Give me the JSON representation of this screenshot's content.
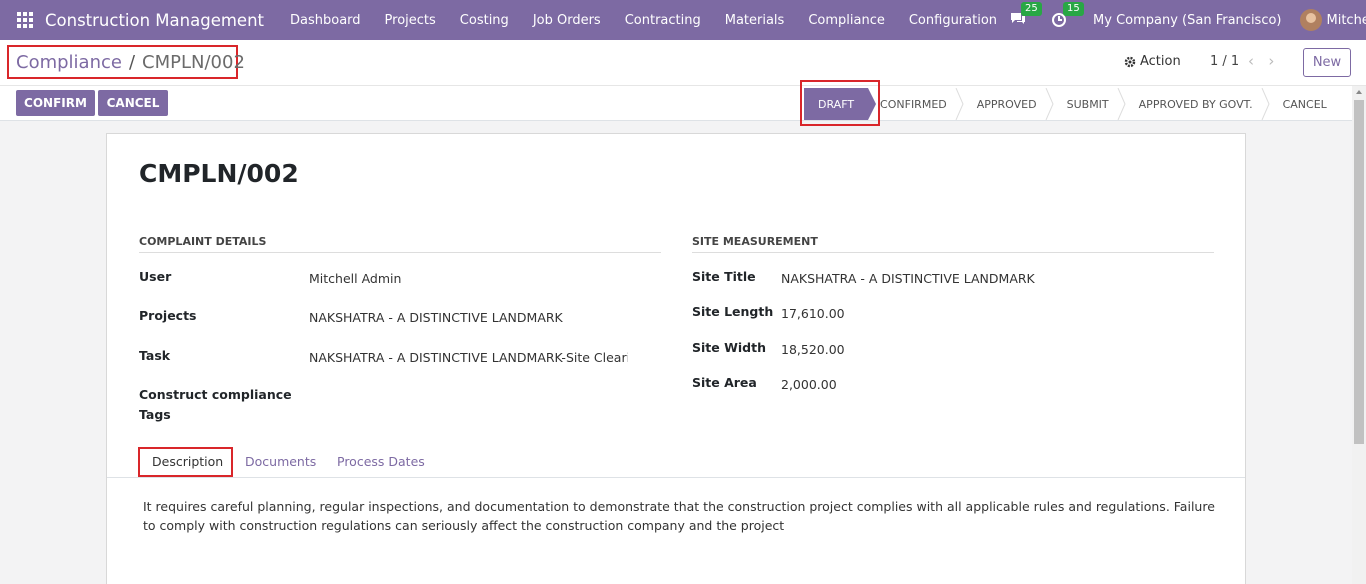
{
  "navbar": {
    "app_title": "Construction Management",
    "menu": [
      "Dashboard",
      "Projects",
      "Costing",
      "Job Orders",
      "Contracting",
      "Materials",
      "Compliance",
      "Configuration"
    ],
    "messages_badge": "25",
    "activities_badge": "15",
    "company": "My Company (San Francisco)",
    "user": "Mitchell Admin",
    "accent_color": "#7d6aa3"
  },
  "control": {
    "breadcrumb_parent": "Compliance",
    "breadcrumb_sep": "/",
    "breadcrumb_current": "CMPLN/002",
    "action_label": "Action",
    "pager": "1 / 1",
    "new_label": "New",
    "confirm_label": "CONFIRM",
    "cancel_label": "CANCEL"
  },
  "status": {
    "stages": [
      "DRAFT",
      "CONFIRMED",
      "APPROVED",
      "SUBMIT",
      "APPROVED BY GOVT.",
      "CANCEL"
    ],
    "active": "DRAFT"
  },
  "record": {
    "name": "CMPLN/002",
    "complaint_details": {
      "title": "COMPLAINT DETAILS",
      "user_label": "User",
      "user_value": "Mitchell Admin",
      "projects_label": "Projects",
      "projects_value": "NAKSHATRA - A DISTINCTIVE LANDMARK",
      "task_label": "Task",
      "task_value": "NAKSHATRA - A DISTINCTIVE LANDMARK-Site Clearing",
      "tags_label_1": "Construct compliance",
      "tags_label_2": "Tags"
    },
    "site_measurement": {
      "title": "SITE MEASUREMENT",
      "site_title_label": "Site Title",
      "site_title_value": "NAKSHATRA - A DISTINCTIVE LANDMARK",
      "length_label": "Site Length",
      "length_value": "17,610.00",
      "width_label": "Site Width",
      "width_value": "18,520.00",
      "area_label": "Site Area",
      "area_value": "2,000.00"
    }
  },
  "tabs": {
    "description": "Description",
    "documents": "Documents",
    "process_dates": "Process Dates"
  },
  "description_text": "It requires careful planning, regular inspections, and documentation to demonstrate that the construction project complies with all applicable rules and regulations. Failure to comply with construction regulations can seriously affect the construction company and the project"
}
